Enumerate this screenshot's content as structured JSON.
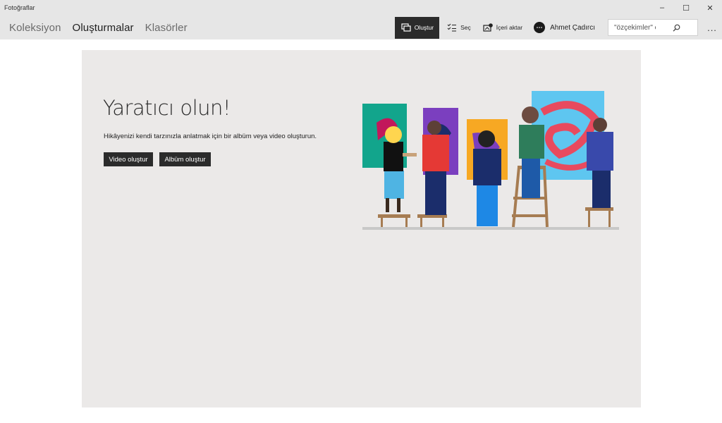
{
  "window": {
    "title": "Fotoğraflar",
    "controls": [
      "–",
      "☐",
      "✕"
    ]
  },
  "nav": {
    "tabs": [
      {
        "label": "Koleksiyon",
        "active": false
      },
      {
        "label": "Oluşturmalar",
        "active": true
      },
      {
        "label": "Klasörler",
        "active": false
      }
    ]
  },
  "commands": {
    "create": {
      "label": "Oluştur",
      "icon": "create-icon"
    },
    "select": {
      "label": "Seç",
      "icon": "select-list-icon"
    },
    "import": {
      "label": "İçeri aktar",
      "icon": "import-icon"
    },
    "account": {
      "name": "Ahmet Çadırcı",
      "icon": "avatar"
    }
  },
  "search": {
    "value": "\"özçekimler\" ögesini",
    "icon": "search-icon"
  },
  "more": {
    "label": "..."
  },
  "hero": {
    "title": "Yaratıcı olun!",
    "subtitle": "Hikâyenizi kendi tarzınızla anlatmak için bir albüm veya video oluşturun.",
    "video_button": "Video oluştur",
    "album_button": "Albüm oluştur",
    "illustration": "artists-painting-illustration"
  },
  "colors": {
    "chrome": "#e6e6e6",
    "panel": "#ebe9e8",
    "button": "#2b2b2b"
  }
}
